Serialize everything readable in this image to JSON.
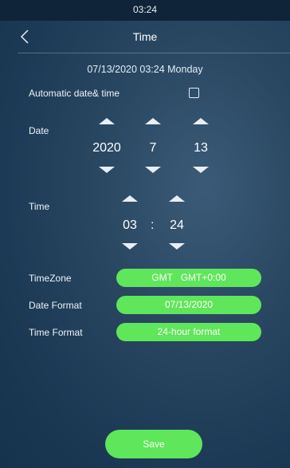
{
  "status_bar": {
    "clock": "03:24"
  },
  "header": {
    "title": "Time"
  },
  "summary": {
    "datetime": "07/13/2020 03:24 Monday"
  },
  "automatic": {
    "label": "Automatic date& time",
    "checked": false
  },
  "date": {
    "label": "Date",
    "year": "2020",
    "month": "7",
    "day": "13"
  },
  "time": {
    "label": "Time",
    "hour": "03",
    "separator": ":",
    "minute": "24"
  },
  "settings": {
    "timezone": {
      "label": "TimeZone",
      "value": "GMT   GMT+0:00"
    },
    "date_format": {
      "label": "Date Format",
      "value": "07/13/2020"
    },
    "time_format": {
      "label": "Time Format",
      "value": "24-hour format"
    }
  },
  "save_label": "Save",
  "colors": {
    "accent": "#5fe65a",
    "background": "#1f3d58"
  }
}
